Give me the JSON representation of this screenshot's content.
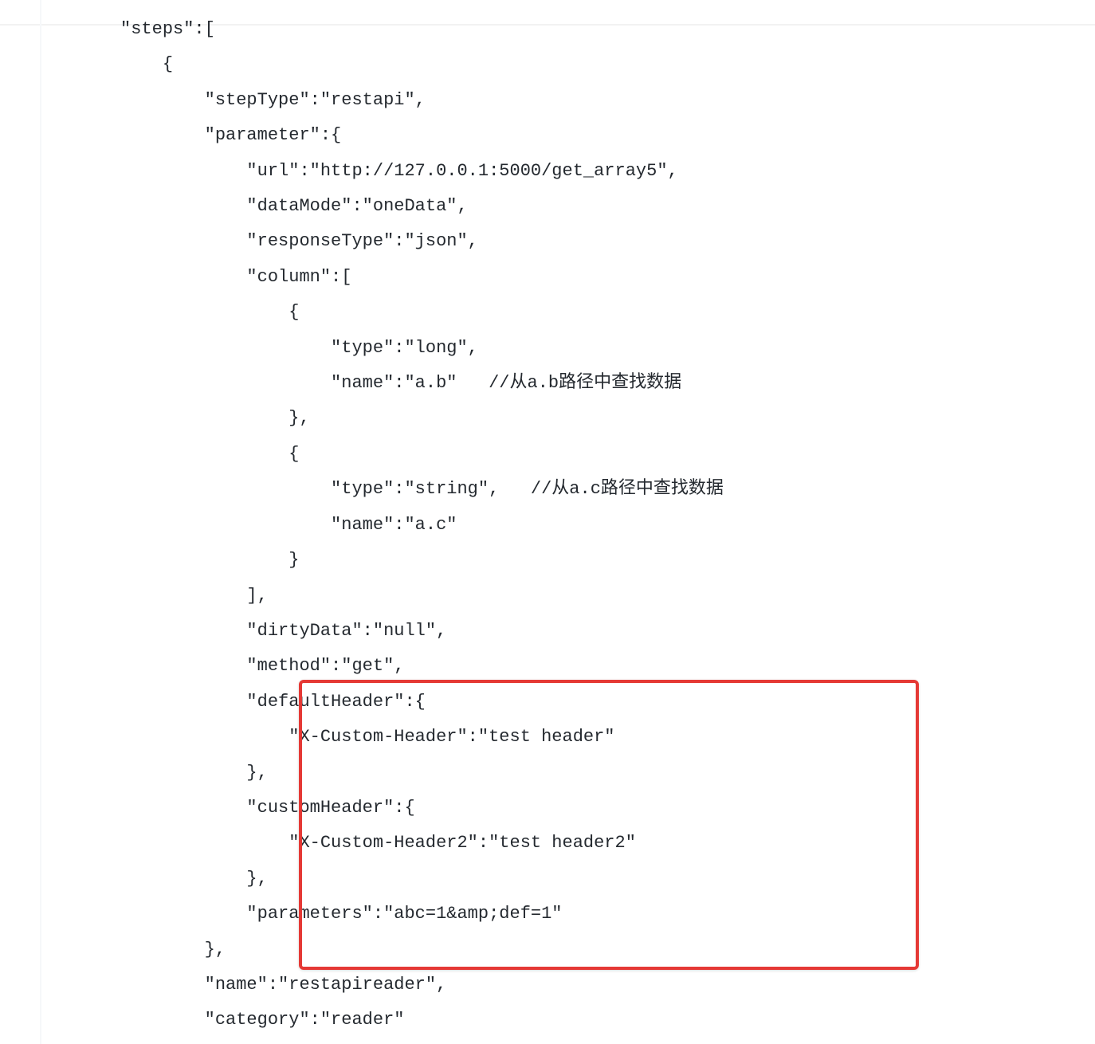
{
  "code": {
    "lines": [
      "     \"steps\":[",
      "         {",
      "             \"stepType\":\"restapi\",",
      "             \"parameter\":{",
      "                 \"url\":\"http://127.0.0.1:5000/get_array5\",",
      "                 \"dataMode\":\"oneData\",",
      "                 \"responseType\":\"json\",",
      "                 \"column\":[",
      "                     {",
      "                         \"type\":\"long\",",
      "                         \"name\":\"a.b\"   //从a.b路径中查找数据",
      "                     },",
      "                     {",
      "                         \"type\":\"string\",   //从a.c路径中查找数据",
      "                         \"name\":\"a.c\"",
      "                     }",
      "                 ],",
      "                 \"dirtyData\":\"null\",",
      "                 \"method\":\"get\",",
      "                 \"defaultHeader\":{",
      "                     \"X-Custom-Header\":\"test header\"",
      "                 },",
      "                 \"customHeader\":{",
      "                     \"X-Custom-Header2\":\"test header2\"",
      "                 },",
      "                 \"parameters\":\"abc=1&amp;def=1\"",
      "             },",
      "             \"name\":\"restapireader\",",
      "             \"category\":\"reader\""
    ]
  }
}
